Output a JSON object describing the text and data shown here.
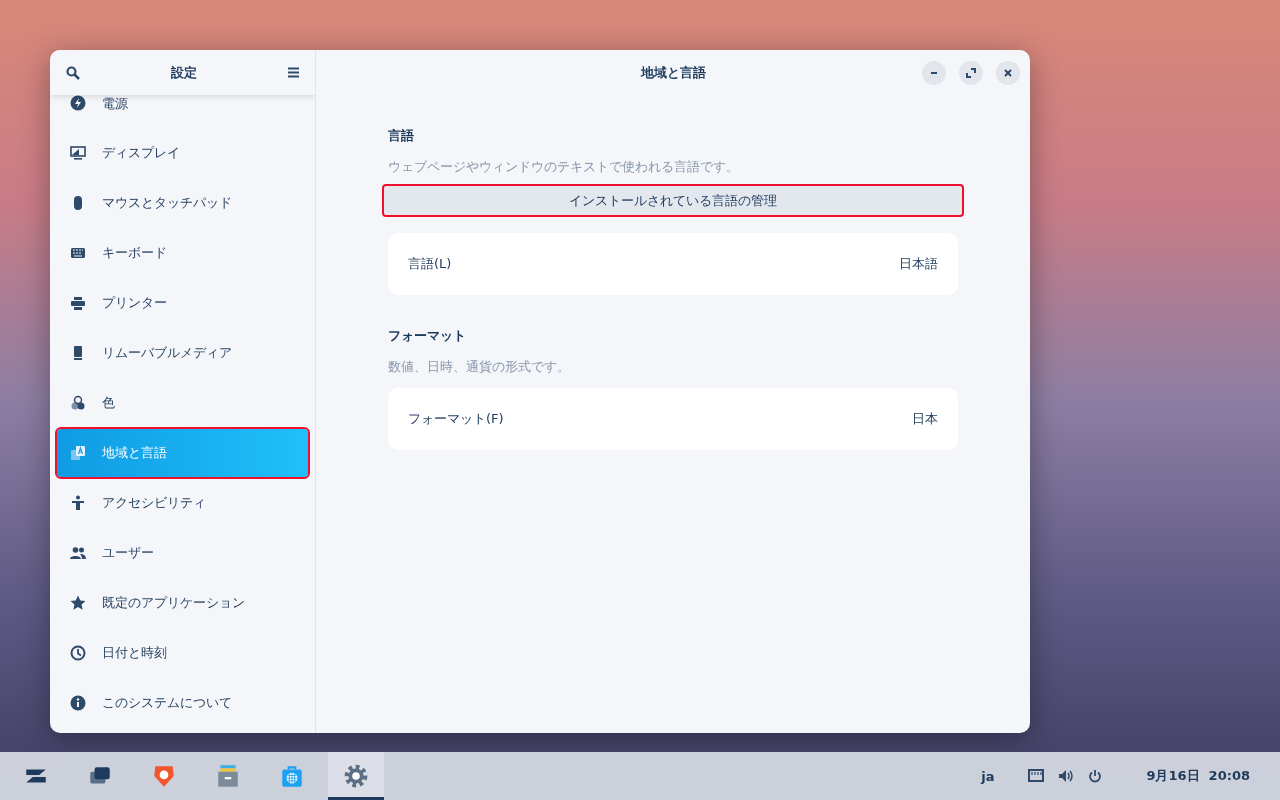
{
  "window": {
    "title": "地域と言語"
  },
  "sidebar": {
    "title": "設定",
    "items": [
      {
        "label": "電源",
        "selected": false,
        "highlighted": false
      },
      {
        "label": "ディスプレイ",
        "selected": false,
        "highlighted": false
      },
      {
        "label": "マウスとタッチパッド",
        "selected": false,
        "highlighted": false
      },
      {
        "label": "キーボード",
        "selected": false,
        "highlighted": false
      },
      {
        "label": "プリンター",
        "selected": false,
        "highlighted": false
      },
      {
        "label": "リムーバブルメディア",
        "selected": false,
        "highlighted": false
      },
      {
        "label": "色",
        "selected": false,
        "highlighted": false
      },
      {
        "label": "地域と言語",
        "selected": true,
        "highlighted": true
      },
      {
        "label": "アクセシビリティ",
        "selected": false,
        "highlighted": false
      },
      {
        "label": "ユーザー",
        "selected": false,
        "highlighted": false
      },
      {
        "label": "既定のアプリケーション",
        "selected": false,
        "highlighted": false
      },
      {
        "label": "日付と時刻",
        "selected": false,
        "highlighted": false
      },
      {
        "label": "このシステムについて",
        "selected": false,
        "highlighted": false
      }
    ]
  },
  "sections": [
    {
      "title": "言語",
      "description": "ウェブページやウィンドウのテキストで使われる言語です。",
      "button": {
        "label": "インストールされている言語の管理",
        "highlighted": true
      },
      "row": {
        "label": "言語(L)",
        "value": "日本語"
      }
    },
    {
      "title": "フォーマット",
      "description": "数値、日時、通貨の形式です。",
      "row": {
        "label": "フォーマット(F)",
        "value": "日本"
      }
    }
  ],
  "taskbar": {
    "apps": [
      {
        "selected": false
      },
      {
        "selected": false
      },
      {
        "selected": false
      },
      {
        "selected": false
      },
      {
        "selected": false
      },
      {
        "selected": true
      }
    ],
    "keyboard_layout": "ja",
    "clock": "9月16日  20:08"
  }
}
